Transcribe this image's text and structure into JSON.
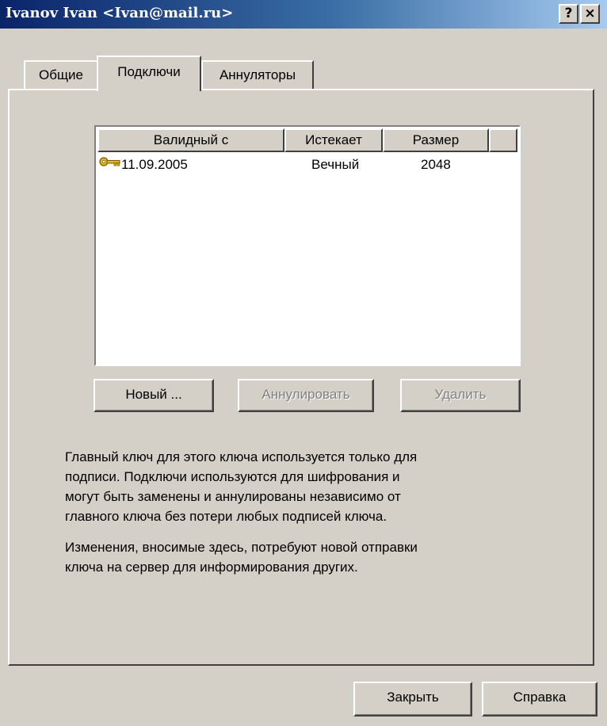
{
  "window": {
    "title": "Ivanov Ivan <Ivan@mail.ru>",
    "help_button": "?",
    "close_button": "×"
  },
  "tabs": [
    {
      "label": "Общие",
      "active": false
    },
    {
      "label": "Подключи",
      "active": true
    },
    {
      "label": "Аннуляторы",
      "active": false
    }
  ],
  "subkeys": {
    "columns": [
      "Валидный с",
      "Истекает",
      "Размер"
    ],
    "rows": [
      {
        "icon": "key-icon",
        "valid_from": "11.09.2005",
        "expires": "Вечный",
        "size": "2048"
      }
    ]
  },
  "actions": {
    "new_label": "Новый ...",
    "revoke_label": "Аннулировать",
    "delete_label": "Удалить"
  },
  "description": {
    "paragraph1": [
      "Главный ключ для этого ключа используется только для",
      "подписи. Подключи используются для шифрования и",
      "могут быть заменены и аннулированы независимо от",
      "главного ключа без потери любых подписей ключа."
    ],
    "paragraph2": [
      "Изменения, вносимые здесь, потребуют новой отправки",
      "ключа на сервер для информирования других."
    ]
  },
  "footer": {
    "close_label": "Закрыть",
    "help_label": "Справка"
  },
  "colors": {
    "titlebar_start": "#0a246a",
    "titlebar_end": "#a6caf0",
    "face": "#d4d0c8",
    "key_gold": "#d8a000"
  }
}
